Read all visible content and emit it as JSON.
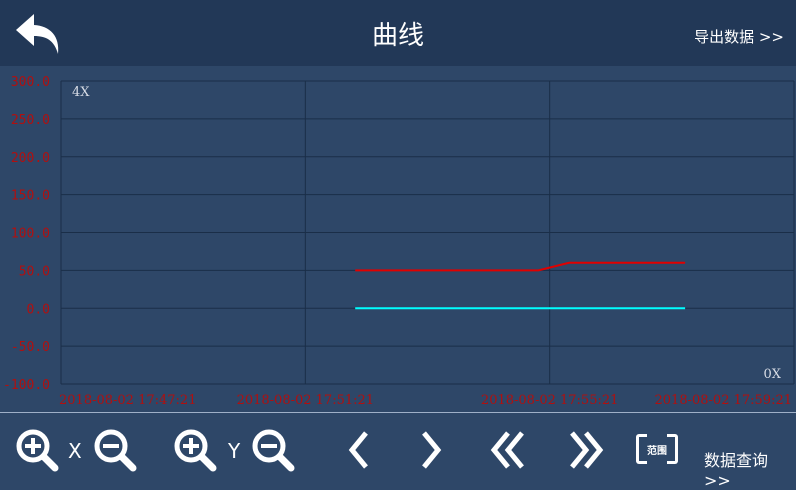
{
  "header": {
    "title": "曲线",
    "export_label": "导出数据 >>"
  },
  "chart_data": {
    "type": "line",
    "ylim": [
      -100,
      300
    ],
    "y_ticks": [
      "300.0",
      "250.0",
      "200.0",
      "150.0",
      "100.0",
      "50.0",
      "0.0",
      "-50.0",
      "-100.0"
    ],
    "y_tick_values": [
      300,
      250,
      200,
      150,
      100,
      50,
      0,
      -50,
      -100
    ],
    "x_ticks": [
      "2018-08-02 17:47:21",
      "2018-08-02 17:51:21",
      "2018-08-02 17:55:21",
      "2018-08-02 17:59:21"
    ],
    "xlim_seconds": [
      0,
      720
    ],
    "y_zoom_label": "4X",
    "x_zoom_label": "0X",
    "series": [
      {
        "color": "#e00000",
        "x_seconds": [
          289,
          469,
          499,
          613
        ],
        "values": [
          50,
          50,
          60,
          60
        ]
      },
      {
        "color": "#00ffff",
        "x_seconds": [
          289,
          613
        ],
        "values": [
          0,
          0
        ]
      }
    ],
    "tick_color": "#b01010",
    "grid_color": "#1a2e48"
  },
  "toolbar": {
    "x_label": "X",
    "y_label": "Y",
    "range_label": "范围",
    "query_label": "数据查询 >>"
  }
}
